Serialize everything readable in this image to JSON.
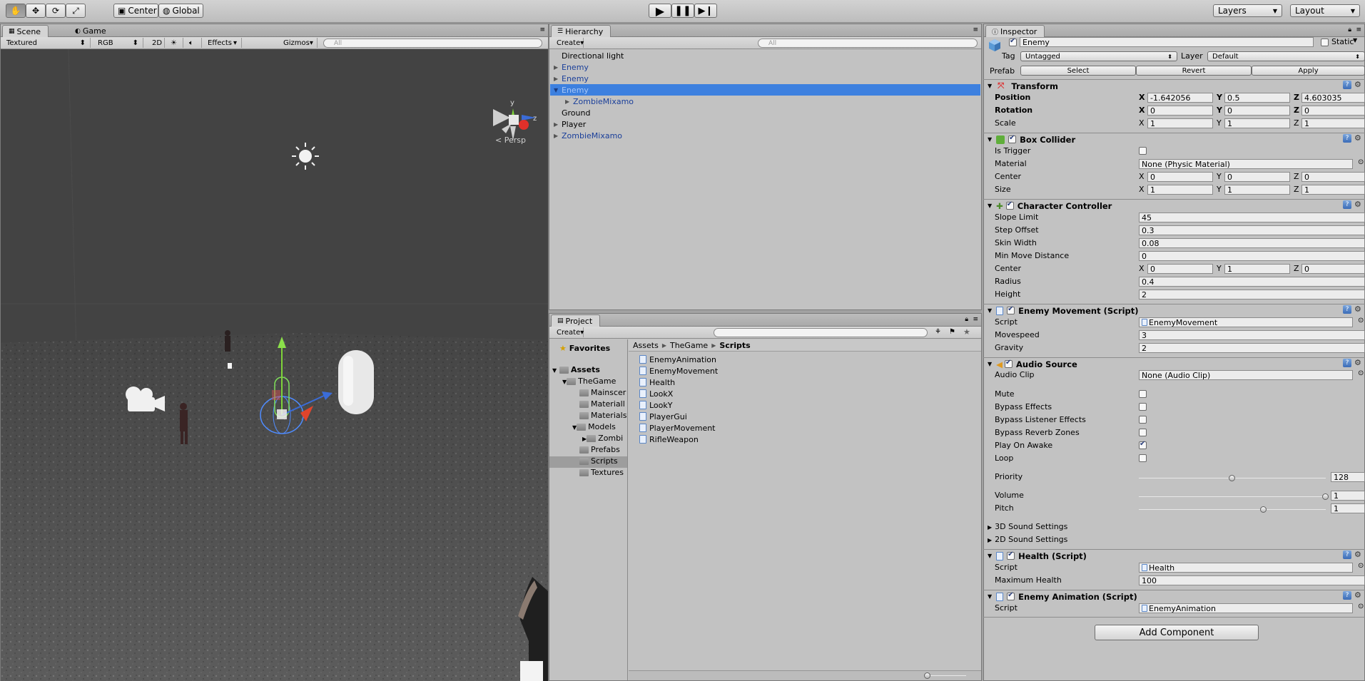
{
  "toolbar": {
    "pivot": "Center",
    "space": "Global",
    "layers": "Layers",
    "layout": "Layout"
  },
  "scene": {
    "tab_scene": "Scene",
    "tab_game": "Game",
    "render_mode": "Textured",
    "color_mode": "RGB",
    "mode_2d": "2D",
    "effects": "Effects",
    "gizmos": "Gizmos",
    "search_placeholder": "All",
    "gizmo_y": "y",
    "gizmo_z": "z",
    "persp": "Persp"
  },
  "hierarchy": {
    "tab": "Hierarchy",
    "create": "Create",
    "search_placeholder": "All",
    "items": [
      {
        "label": "Directional light"
      },
      {
        "label": "Enemy"
      },
      {
        "label": "Enemy"
      },
      {
        "label": "Enemy"
      },
      {
        "label": "ZombieMixamo"
      },
      {
        "label": "Ground"
      },
      {
        "label": "Player"
      },
      {
        "label": "ZombieMixamo"
      }
    ]
  },
  "project": {
    "tab": "Project",
    "create": "Create",
    "favorites": "Favorites",
    "tree": [
      "Assets",
      "TheGame",
      "Mainscer",
      "Materiall",
      "Materials",
      "Models",
      "Zombi",
      "Prefabs",
      "Scripts",
      "Textures"
    ],
    "breadcrumb": [
      "Assets",
      "TheGame",
      "Scripts"
    ],
    "files": [
      "EnemyAnimation",
      "EnemyMovement",
      "Health",
      "LookX",
      "LookY",
      "PlayerGui",
      "PlayerMovement",
      "RifleWeapon"
    ]
  },
  "inspector": {
    "tab": "Inspector",
    "object_name": "Enemy",
    "static": "Static",
    "tag_label": "Tag",
    "tag_value": "Untagged",
    "layer_label": "Layer",
    "layer_value": "Default",
    "prefab_label": "Prefab",
    "prefab_select": "Select",
    "prefab_revert": "Revert",
    "prefab_apply": "Apply",
    "transform": {
      "title": "Transform",
      "position": "Position",
      "pos_x": "-1.642056",
      "pos_y": "0.5",
      "pos_z": "4.603035",
      "rotation": "Rotation",
      "rot_x": "0",
      "rot_y": "0",
      "rot_z": "0",
      "scale": "Scale",
      "scl_x": "1",
      "scl_y": "1",
      "scl_z": "1",
      "x": "X",
      "y": "Y",
      "z": "Z"
    },
    "box_collider": {
      "title": "Box Collider",
      "is_trigger": "Is Trigger",
      "material": "Material",
      "material_value": "None (Physic Material)",
      "center": "Center",
      "c_x": "0",
      "c_y": "0",
      "c_z": "0",
      "size": "Size",
      "s_x": "1",
      "s_y": "1",
      "s_z": "1"
    },
    "character_controller": {
      "title": "Character Controller",
      "slope_limit": "Slope Limit",
      "slope_value": "45",
      "step_offset": "Step Offset",
      "step_value": "0.3",
      "skin_width": "Skin Width",
      "skin_value": "0.08",
      "min_move": "Min Move Distance",
      "min_move_value": "0",
      "center": "Center",
      "c_x": "0",
      "c_y": "1",
      "c_z": "0",
      "radius": "Radius",
      "radius_value": "0.4",
      "height": "Height",
      "height_value": "2"
    },
    "enemy_movement": {
      "title": "Enemy Movement (Script)",
      "script": "Script",
      "script_value": "EnemyMovement",
      "movespeed": "Movespeed",
      "movespeed_value": "3",
      "gravity": "Gravity",
      "gravity_value": "2"
    },
    "audio_source": {
      "title": "Audio Source",
      "audio_clip": "Audio Clip",
      "audio_clip_value": "None (Audio Clip)",
      "mute": "Mute",
      "bypass_effects": "Bypass Effects",
      "bypass_listener": "Bypass Listener Effects",
      "bypass_reverb": "Bypass Reverb Zones",
      "play_on_awake": "Play On Awake",
      "loop": "Loop",
      "priority": "Priority",
      "priority_value": "128",
      "priority_level": 0.5,
      "volume": "Volume",
      "volume_value": "1",
      "volume_level": 1.0,
      "pitch": "Pitch",
      "pitch_value": "1",
      "pitch_level": 0.667,
      "settings_3d": "3D Sound Settings",
      "settings_2d": "2D Sound Settings"
    },
    "health": {
      "title": "Health (Script)",
      "script": "Script",
      "script_value": "Health",
      "max_health": "Maximum Health",
      "max_health_value": "100"
    },
    "enemy_animation": {
      "title": "Enemy Animation (Script)",
      "script": "Script",
      "script_value": "EnemyAnimation"
    },
    "add_component": "Add Component"
  }
}
